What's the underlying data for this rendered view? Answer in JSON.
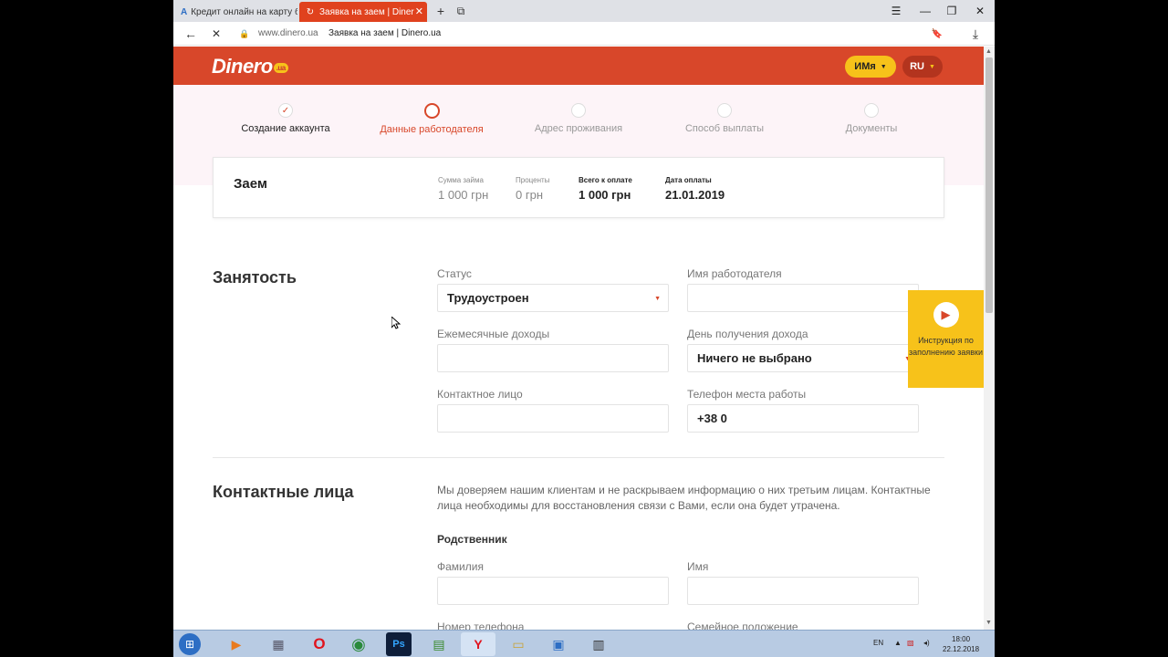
{
  "browser": {
    "tabs": [
      {
        "label": "Кредит онлайн на карту б",
        "favicon": "A"
      },
      {
        "label": "Заявка на заем | Diner",
        "favicon": "↻"
      }
    ],
    "new_tab_icon": "+",
    "tab_overview_icon": "⧉",
    "window_controls": {
      "menu": "☰",
      "minimize": "—",
      "restore": "❐",
      "close": "✕"
    },
    "back_icon": "←",
    "stop_icon": "✕",
    "lock_icon": "🔒",
    "address_domain": "www.dinero.ua",
    "address_title": "Заявка на заем | Dinero.ua",
    "bookmark_icon": "🔖",
    "download_icon": "⤓"
  },
  "site": {
    "logo": "Dinero",
    "logo_suffix": ".ua",
    "name_button": "ИМя",
    "lang_button": "RU",
    "colors": {
      "brand": "#d8472a",
      "accent": "#f7c21a"
    }
  },
  "steps": [
    {
      "label": "Создание аккаунта",
      "state": "done",
      "mark": "✓"
    },
    {
      "label": "Данные работодателя",
      "state": "current",
      "mark": ""
    },
    {
      "label": "Адрес проживания",
      "state": "pending",
      "mark": ""
    },
    {
      "label": "Способ выплаты",
      "state": "pending",
      "mark": ""
    },
    {
      "label": "Документы",
      "state": "pending",
      "mark": ""
    }
  ],
  "loan": {
    "title": "Заем",
    "amount_label": "Сумма займа",
    "amount_value": "1 000 грн",
    "interest_label": "Проценты",
    "interest_value": "0 грн",
    "total_label": "Всего к оплате",
    "total_value": "1 000 грн",
    "date_label": "Дата оплаты",
    "date_value": "21.01.2019"
  },
  "employment": {
    "title": "Занятость",
    "status_label": "Статус",
    "status_value": "Трудоустроен",
    "employer_label": "Имя работодателя",
    "employer_value": "",
    "income_label": "Ежемесячные доходы",
    "income_value": "",
    "payday_label": "День получения дохода",
    "payday_value": "Ничего не выбрано",
    "contact_label": "Контактное лицо",
    "contact_value": "",
    "work_phone_label": "Телефон места работы",
    "work_phone_value": "+38 0"
  },
  "help": {
    "play_icon": "▶",
    "text": "Инструкция по заполнению заявки"
  },
  "contacts": {
    "title": "Контактные лица",
    "description": "Мы доверяем нашим клиентам и не раскрываем информацию о них третьим лицам. Контактные лица необходимы для восстановления связи с Вами, если она будет утрачена.",
    "relative_title": "Родственник",
    "surname_label": "Фамилия",
    "name_label": "Имя",
    "phone_label": "Номер телефона",
    "marital_label": "Семейное положение"
  },
  "taskbar": {
    "start_icon": "⊞",
    "apps": [
      "▶",
      "▦",
      "O",
      "◉",
      "Ps",
      "▤",
      "Y",
      "▭",
      "▣",
      "▥"
    ],
    "lang": "EN",
    "time": "18:00",
    "date": "22.12.2018"
  }
}
